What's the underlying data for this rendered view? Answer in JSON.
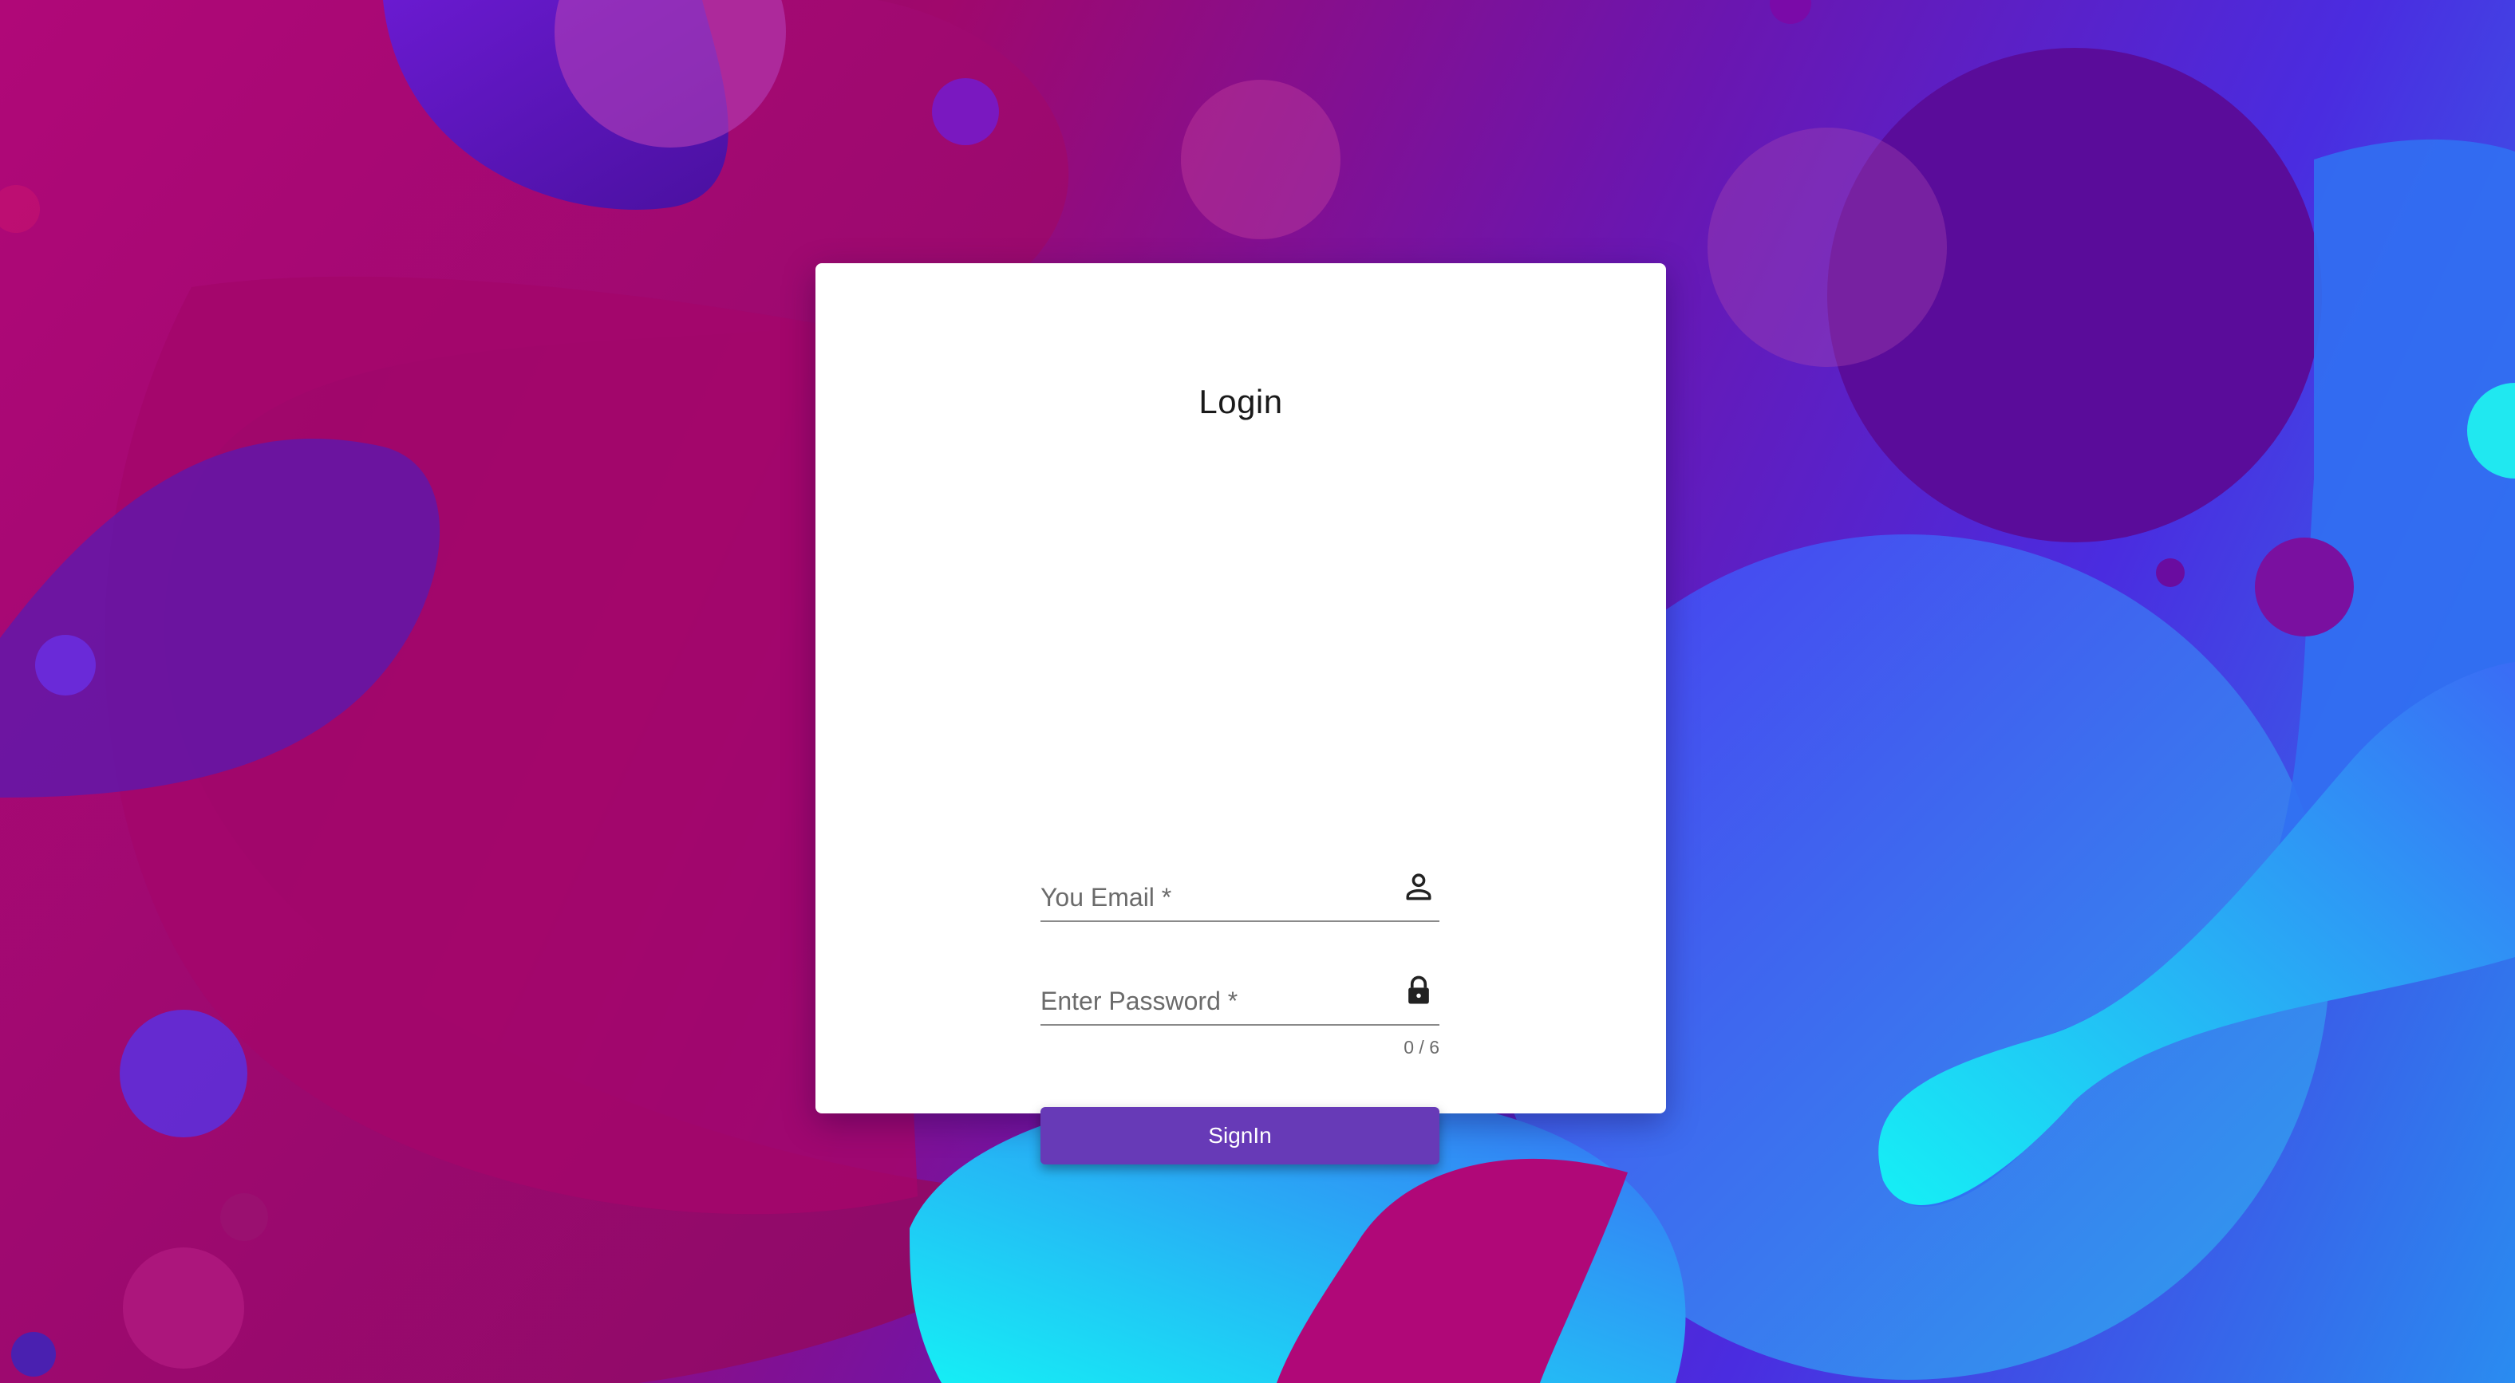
{
  "login": {
    "title": "Login",
    "email_label": "You Email *",
    "password_label": "Enter Password *",
    "password_counter": "0 / 6",
    "signin_label": "SignIn"
  },
  "colors": {
    "primary_button": "#673ab7",
    "card_background": "#ffffff"
  },
  "icons": {
    "email": "person-icon",
    "password": "lock-icon"
  }
}
